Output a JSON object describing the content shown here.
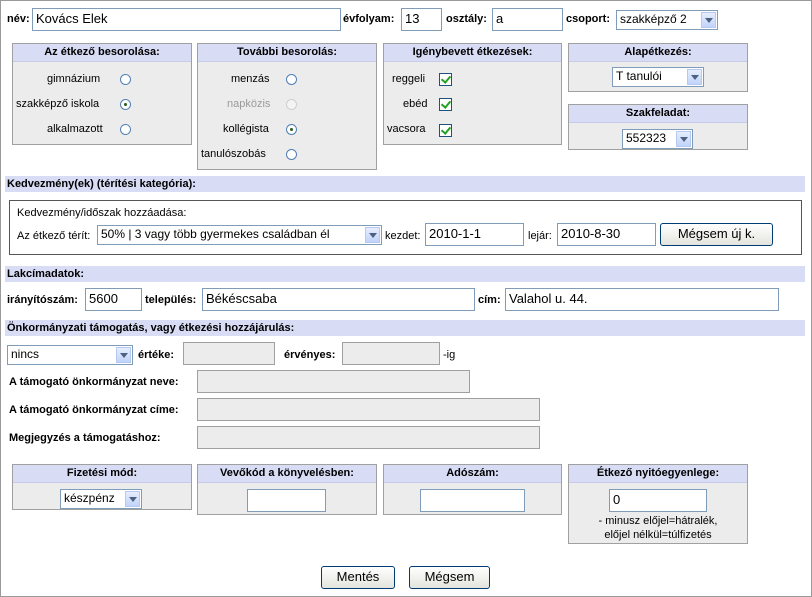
{
  "top": {
    "name_label": "név:",
    "name_value": "Kovács Elek",
    "year_label": "évfolyam:",
    "year_value": "13",
    "class_label": "osztály:",
    "class_value": "a",
    "group_label": "csoport:",
    "group_value": "szakképző 2"
  },
  "classification": {
    "title": "Az étkező besorolása:",
    "options": [
      {
        "label": "gimnázium",
        "selected": false
      },
      {
        "label": "szakképző iskola",
        "selected": true
      },
      {
        "label": "alkalmazott",
        "selected": false
      }
    ]
  },
  "further": {
    "title": "További besorolás:",
    "options": [
      {
        "label": "menzás",
        "selected": false,
        "disabled": false
      },
      {
        "label": "napközis",
        "selected": false,
        "disabled": true
      },
      {
        "label": "kollégista",
        "selected": true,
        "disabled": false
      },
      {
        "label": "tanulószobás",
        "selected": false,
        "disabled": false
      }
    ]
  },
  "meals": {
    "title": "Igénybevett étkezések:",
    "items": [
      {
        "label": "reggeli",
        "checked": true
      },
      {
        "label": "ebéd",
        "checked": true
      },
      {
        "label": "vacsora",
        "checked": true
      }
    ]
  },
  "base_meal": {
    "title": "Alapétkezés:",
    "value": "T tanulói"
  },
  "task": {
    "title": "Szakfeladat:",
    "value": "552323"
  },
  "discount": {
    "bar": "Kedvezmény(ek) (térítési kategória):",
    "add_title": "Kedvezmény/időszak hozzáadása:",
    "pays_label": "Az étkező térít:",
    "pays_value": "50% | 3 vagy több gyermekes családban él",
    "start_label": "kezdet:",
    "start_value": "2010-1-1",
    "end_label": "lejár:",
    "end_value": "2010-8-30",
    "cancel_new": "Mégsem új k."
  },
  "address": {
    "bar": "Lakcímadatok:",
    "zip_label": "irányítószám:",
    "zip_value": "5600",
    "city_label": "település:",
    "city_value": "Békéscsaba",
    "street_label": "cím:",
    "street_value": "Valahol u. 44."
  },
  "support": {
    "bar": "Önkormányzati támogatás, vagy étkezési hozzájárulás:",
    "type_value": "nincs",
    "value_label": "értéke:",
    "valid_label": "érvényes:",
    "valid_suffix": "-ig",
    "name_label": "A támogató önkormányzat neve:",
    "addr_label": "A támogató önkormányzat címe:",
    "note_label": "Megjegyzés a támogatáshoz:"
  },
  "payment": {
    "title": "Fizetési mód:",
    "value": "készpénz"
  },
  "buyer": {
    "title": "Vevőkód a könyvelésben:"
  },
  "tax": {
    "title": "Adószám:"
  },
  "balance": {
    "title": "Étkező nyitóegyenlege:",
    "value": "0",
    "note1": "- minusz előjel=hátralék,",
    "note2": "előjel nélkül=túlfizetés"
  },
  "buttons": {
    "save": "Mentés",
    "cancel": "Mégsem"
  }
}
